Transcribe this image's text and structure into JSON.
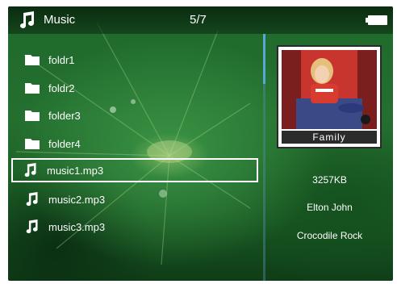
{
  "header": {
    "icon": "music-note-icon",
    "title": "Music",
    "counter": "5/7",
    "battery_icon": "battery-full-icon"
  },
  "list": {
    "items": [
      {
        "icon": "folder-icon",
        "label": "foldr1"
      },
      {
        "icon": "folder-icon",
        "label": "foldr2"
      },
      {
        "icon": "folder-icon",
        "label": "folder3"
      },
      {
        "icon": "folder-icon",
        "label": "folder4"
      },
      {
        "icon": "music-note-icon",
        "label": "music1.mp3",
        "selected": true
      },
      {
        "icon": "music-note-icon",
        "label": "music2.mp3"
      },
      {
        "icon": "music-note-icon",
        "label": "music3.mp3"
      }
    ]
  },
  "details": {
    "album_caption": "Family",
    "file_size": "3257KB",
    "artist": "Elton John",
    "title": "Crocodile Rock"
  },
  "colors": {
    "selection_border": "#ffffff",
    "scroll_thumb": "#5aa6d6",
    "background": "#1f6a2c"
  }
}
